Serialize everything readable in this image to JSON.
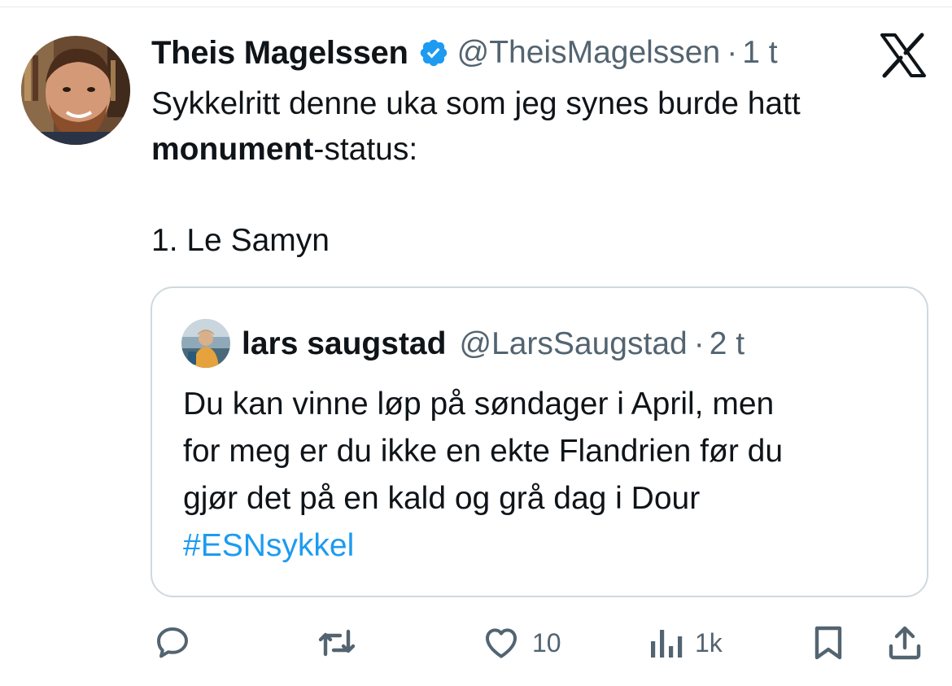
{
  "tweet": {
    "author": {
      "name": "Theis Magelssen",
      "handle": "@TheisMagelssen",
      "verified": true
    },
    "time": "1 t",
    "separator": "·",
    "text": {
      "line1": "Sykkelritt denne uka som jeg synes burde hatt",
      "line2_bold": "monument",
      "line2_rest": "-status:",
      "line4": "1. Le Samyn"
    }
  },
  "quote": {
    "author": {
      "name": "lars saugstad",
      "handle": "@LarsSaugstad"
    },
    "time": "2 t",
    "separator": "·",
    "text": {
      "line1": "Du kan vinne løp på søndager i April, men",
      "line2": "for meg er du ikke en ekte Flandrien før du",
      "line3": "gjør det på en kald og grå dag i Dour",
      "hashtag": "#ESNsykkel"
    }
  },
  "actions": {
    "likes": "10",
    "views": "1k"
  },
  "colors": {
    "text": "#0f1419",
    "secondary": "#536471",
    "verified": "#1d9bf0",
    "link": "#1d9bf0",
    "border": "#cfd9de"
  },
  "icons": {
    "reply": "speech-bubble",
    "retweet": "arrows-loop",
    "like": "heart",
    "views": "bar-chart",
    "bookmark": "bookmark",
    "share": "upload-arrow",
    "logo": "x-logo",
    "verified": "verified-badge"
  }
}
